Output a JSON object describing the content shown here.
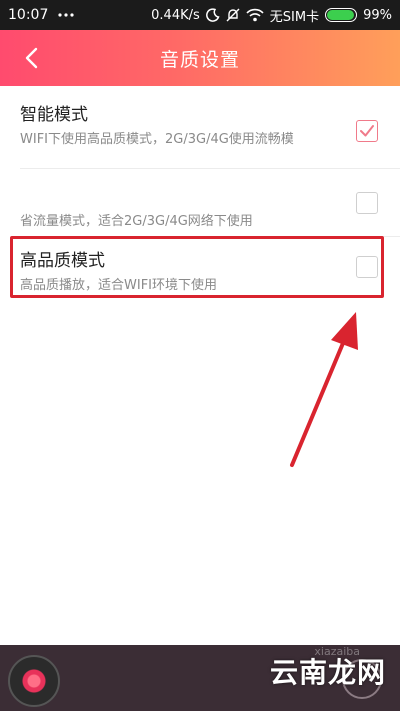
{
  "status_bar": {
    "time": "10:07",
    "network_speed": "0.44K/s",
    "sim_label": "无SIM卡",
    "battery_percent_text": "99%",
    "battery_level": 0.99
  },
  "header": {
    "title": "音质设置",
    "back_icon": "chevron-left-icon"
  },
  "options": [
    {
      "title": "智能模式",
      "description": "WIFI下使用高品质模式，2G/3G/4G使用流畅模",
      "checked": true
    },
    {
      "title": "",
      "description": "省流量模式，适合2G/3G/4G网络下使用",
      "checked": false
    },
    {
      "title": "高品质模式",
      "description": "高品质播放，适合WIFI环境下使用",
      "checked": false
    }
  ],
  "colors": {
    "accent": "#ff5a6e",
    "highlight_box": "#d9242f",
    "arrow": "#d9242f",
    "player_bar": "#3b2d35"
  },
  "player_bar": {
    "watermark": "云南龙网",
    "faint_watermark": "xiazaiba"
  }
}
